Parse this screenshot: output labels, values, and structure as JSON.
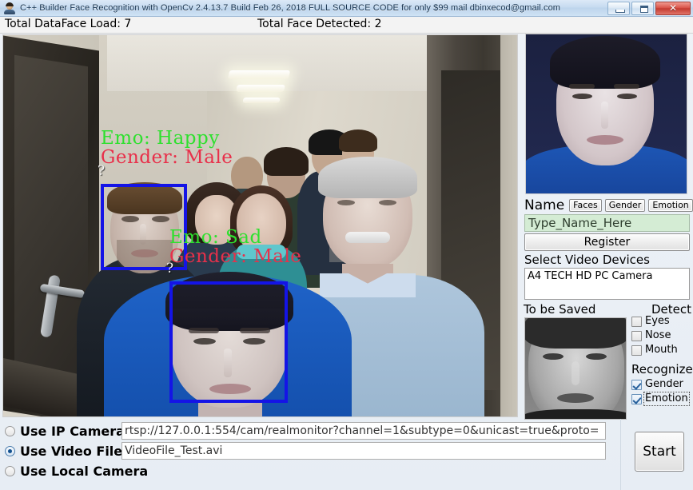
{
  "window": {
    "title": "C++ Builder Face Recognition with OpenCv 2.4.13.7 Build Feb 26, 2018 FULL SOURCE CODE for only $99 mail dbinxecod@gmail.com",
    "app_icon": "person-avatar-icon",
    "minimize_label": "",
    "maximize_label": "",
    "close_label": "✕"
  },
  "status": {
    "dataface_load": "Total DataFace Load: 7",
    "faces_detected": "Total Face Detected: 2"
  },
  "video": {
    "overlays": [
      {
        "emotion": "Emo: Happy",
        "gender": "Gender: Male",
        "marker": "?"
      },
      {
        "emotion": "Emo: Sad",
        "gender": "Gender: Male",
        "marker": "?"
      }
    ],
    "box_color": "#1414e6",
    "emotion_color": "#2ee02e",
    "gender_color": "#e8304a"
  },
  "right_panel": {
    "name_label": "Name",
    "buttons": [
      {
        "label": "Faces"
      },
      {
        "label": "Gender"
      },
      {
        "label": "Emotion"
      }
    ],
    "name_value": "Type_Name_Here",
    "name_field_bg": "#d4ecd4",
    "register_label": "Register",
    "devices_label": "Select Video Devices",
    "devices": [
      "A4 TECH HD PC Camera"
    ],
    "to_be_saved_label": "To be Saved",
    "detect_label": "Detect",
    "detect_items": [
      {
        "label": "Eyes",
        "checked": false
      },
      {
        "label": "Nose",
        "checked": false
      },
      {
        "label": "Mouth",
        "checked": false
      }
    ],
    "recognize_label": "Recognize",
    "recognize_items": [
      {
        "label": "Gender",
        "checked": true,
        "focused": false
      },
      {
        "label": "Emotion",
        "checked": true,
        "focused": true
      }
    ]
  },
  "source": {
    "options": [
      {
        "label": "Use IP Camera",
        "selected": false
      },
      {
        "label": "Use Video File",
        "selected": true
      },
      {
        "label": "Use Local Camera",
        "selected": false
      }
    ],
    "ip_url": "rtsp://127.0.0.1:554/cam/realmonitor?channel=1&subtype=0&unicast=true&proto=",
    "video_file": "VideoFile_Test.avi",
    "start_label": "Start"
  }
}
